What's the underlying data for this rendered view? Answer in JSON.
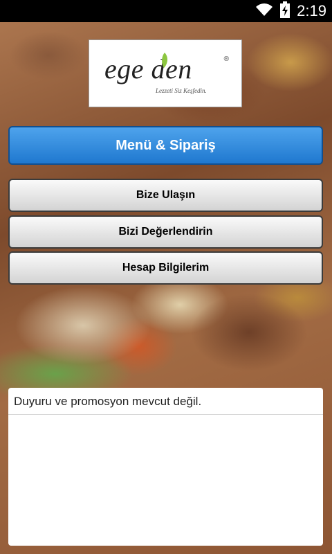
{
  "status_bar": {
    "time": "2:19",
    "icons": [
      "wifi-icon",
      "battery-charging-icon"
    ]
  },
  "logo": {
    "brand": "ege den",
    "tagline": "Lezzeti Siz Keşfedin."
  },
  "menu": {
    "primary_label": "Menü & Sipariş",
    "contact_label": "Bize Ulaşın",
    "rate_label": "Bizi Değerlendirin",
    "account_label": "Hesap Bilgilerim"
  },
  "announcements": {
    "text": "Duyuru ve promosyon mevcut değil."
  },
  "colors": {
    "primary_button": "#2a86dd",
    "secondary_button": "#e6e6e6",
    "status_bar": "#000000"
  }
}
